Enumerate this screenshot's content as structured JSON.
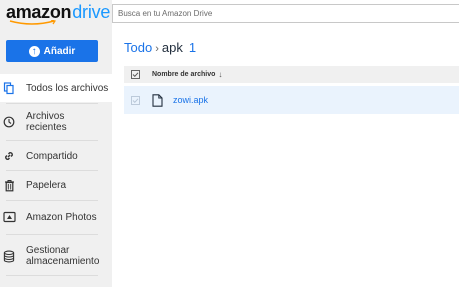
{
  "logo": {
    "amazon": "amazon",
    "drive": "drive"
  },
  "search": {
    "placeholder": "Busca en tu Amazon Drive"
  },
  "sidebar": {
    "add_button": "Añadir",
    "items": [
      {
        "label": "Todos los archivos",
        "icon": "files-icon",
        "active": true
      },
      {
        "label": "Archivos recientes",
        "icon": "clock-icon",
        "active": false
      },
      {
        "label": "Compartido",
        "icon": "link-icon",
        "active": false
      },
      {
        "label": "Papelera",
        "icon": "trash-icon",
        "active": false
      },
      {
        "label": "Amazon Photos",
        "icon": "photos-icon",
        "active": false
      },
      {
        "label": "Gestionar almacenamiento",
        "icon": "storage-icon",
        "active": false
      }
    ]
  },
  "breadcrumb": {
    "root": "Todo",
    "separator": "›",
    "current": "apk",
    "count": "1"
  },
  "table": {
    "column_name": "Nombre de archivo",
    "sort_indicator": "↓",
    "rows": [
      {
        "name": "zowi.apk",
        "type": "file"
      }
    ]
  },
  "colors": {
    "accent": "#1a73e8",
    "sidebar_bg": "#f0f0f0",
    "row_selected": "#eaf3fd",
    "logo_drive": "#1a98ff"
  }
}
